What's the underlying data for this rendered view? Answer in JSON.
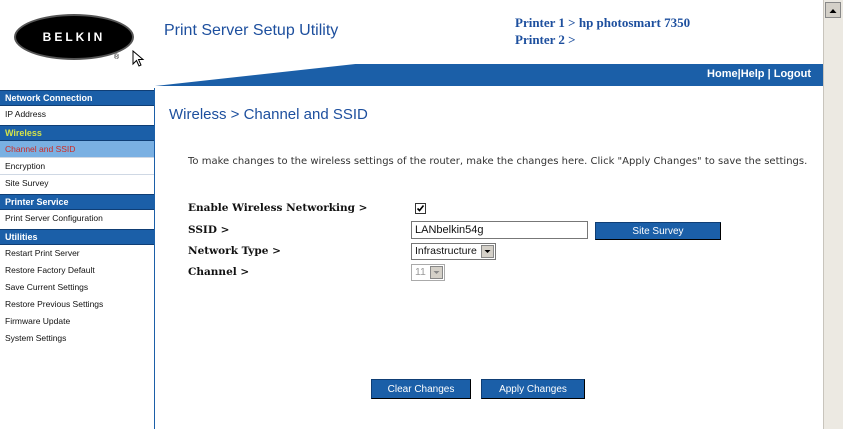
{
  "header": {
    "brand": "BELKIN",
    "app_title": "Print Server Setup Utility",
    "printer1": "Printer 1 > hp photosmart 7350",
    "printer2": "Printer 2 >",
    "nav": {
      "home": "Home",
      "help": "Help",
      "logout": "Logout",
      "sep": "|"
    }
  },
  "sidebar": {
    "sections": [
      {
        "title": "Network Connection",
        "items": [
          "IP Address"
        ]
      },
      {
        "title": "Wireless",
        "items": [
          "Channel and SSID",
          "Encryption",
          "Site Survey"
        ]
      },
      {
        "title": "Printer Service",
        "items": [
          "Print Server Configuration"
        ]
      },
      {
        "title": "Utilities",
        "items": [
          "Restart Print Server",
          "Restore Factory Default",
          "Save Current Settings",
          "Restore Previous Settings",
          "Firmware Update",
          "System Settings"
        ]
      }
    ]
  },
  "main": {
    "title": "Wireless > Channel and SSID",
    "intro": "To make changes to the wireless settings of the router, make the changes here. Click \"Apply Changes\" to save the settings.",
    "enable_label": "Enable Wireless Networking >",
    "enable_checked": true,
    "ssid_label": "SSID >",
    "ssid_value": "LANbelkin54g",
    "site_survey_button": "Site Survey",
    "network_type_label": "Network Type >",
    "network_type_value": "Infrastructure",
    "channel_label": "Channel >",
    "channel_value": "11",
    "clear_button": "Clear Changes",
    "apply_button": "Apply Changes"
  },
  "colors": {
    "accent": "#1b5fa8",
    "active_section": "#d4e34a",
    "current_item_bg": "#7ab0e2",
    "current_item_text": "#cf2a23"
  }
}
